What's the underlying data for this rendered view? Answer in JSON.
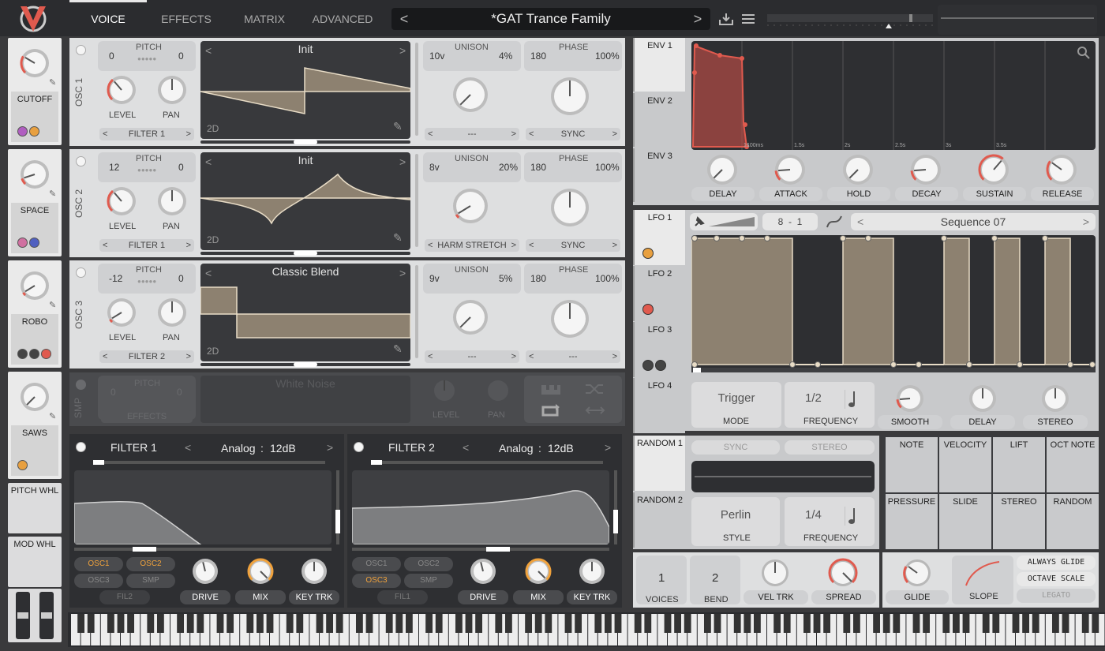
{
  "tabs": [
    "VOICE",
    "EFFECTS",
    "MATRIX",
    "ADVANCED"
  ],
  "preset": {
    "name": "*GAT Trance Family",
    "prev": "<",
    "next": ">"
  },
  "icons": {
    "save": "save-icon",
    "menu": "menu-icon",
    "search": "search-icon",
    "edit": "pencil-icon",
    "shuffle": "shuffle-icon",
    "loop": "loop-icon",
    "bounce": "bounce-icon",
    "keytrack": "keytrack-icon",
    "curve": "curve-icon",
    "note": "note-icon",
    "pin": "pin-icon"
  },
  "colors": {
    "accent": "#e05a4e",
    "brand_bg": "#2b2c2f",
    "panel": "#dedfe0",
    "wave_fill": "#8d8170",
    "orange": "#f0a23c"
  },
  "macros": [
    {
      "label": "CUTOFF",
      "value": 0.28
    },
    {
      "label": "SPACE",
      "value": 0.1
    },
    {
      "label": "ROBO",
      "value": 0.05
    },
    {
      "label": "SAWS",
      "value": 0.0
    },
    {
      "label": "PITCH WHL",
      "value": null
    },
    {
      "label": "MOD WHL",
      "value": null
    }
  ],
  "oscs": [
    {
      "label": "OSC 1",
      "pitch_left": "0",
      "pitch_right": "0",
      "pitch": "PITCH",
      "wave": "Init",
      "dim": "2D",
      "level": "LEVEL",
      "pan": "PAN",
      "filter": "FILTER 1",
      "unison_voices": "10v",
      "unison": "UNISON",
      "unison_detune": "4%",
      "phase_val": "180",
      "phase": "PHASE",
      "phase_rand": "100%",
      "spectral": "---",
      "sync": "SYNC"
    },
    {
      "label": "OSC 2",
      "pitch_left": "12",
      "pitch_right": "0",
      "pitch": "PITCH",
      "wave": "Init",
      "dim": "2D",
      "level": "LEVEL",
      "pan": "PAN",
      "filter": "FILTER 1",
      "unison_voices": "8v",
      "unison": "UNISON",
      "unison_detune": "20%",
      "phase_val": "180",
      "phase": "PHASE",
      "phase_rand": "100%",
      "spectral": "HARM STRETCH",
      "sync": "SYNC"
    },
    {
      "label": "OSC 3",
      "pitch_left": "-12",
      "pitch_right": "0",
      "pitch": "PITCH",
      "wave": "Classic Blend",
      "dim": "2D",
      "level": "LEVEL",
      "pan": "PAN",
      "filter": "FILTER 2",
      "unison_voices": "9v",
      "unison": "UNISON",
      "unison_detune": "5%",
      "phase_val": "180",
      "phase": "PHASE",
      "phase_rand": "100%",
      "spectral": "---",
      "sync": "---"
    }
  ],
  "smp": {
    "label": "SMP",
    "pitch": "PITCH",
    "pitch_left": "0",
    "pitch_right": "0",
    "dest": "EFFECTS",
    "sample": "White Noise",
    "level": "LEVEL",
    "pan": "PAN"
  },
  "filters": [
    {
      "title": "FILTER 1",
      "model": "Analog",
      "sep": ":",
      "slope": "12dB",
      "drive": "DRIVE",
      "mix": "MIX",
      "keytrk": "KEY TRK",
      "src": [
        "OSC1",
        "OSC2",
        "OSC3",
        "SMP"
      ],
      "active": [
        true,
        true,
        false,
        false
      ],
      "fil": "FIL2"
    },
    {
      "title": "FILTER 2",
      "model": "Analog",
      "sep": ":",
      "slope": "12dB",
      "drive": "DRIVE",
      "mix": "MIX",
      "keytrk": "KEY TRK",
      "src": [
        "OSC1",
        "OSC2",
        "OSC3",
        "SMP"
      ],
      "active": [
        false,
        false,
        true,
        false
      ],
      "fil": "FIL1"
    }
  ],
  "env": {
    "tabs": [
      "ENV 1",
      "ENV 2",
      "ENV 3"
    ],
    "times": [
      "100ms",
      "1s",
      "1.5s",
      "2s",
      "2.5s",
      "3s",
      "3.5s"
    ],
    "knobs": [
      "DELAY",
      "ATTACK",
      "HOLD",
      "DECAY",
      "SUSTAIN",
      "RELEASE"
    ]
  },
  "lfo": {
    "tabs": [
      "LFO 1",
      "LFO 2",
      "LFO 3",
      "LFO 4"
    ],
    "grid_num": "8",
    "grid_sep": "-",
    "grid_den": "1",
    "shape": "Sequence 07",
    "mode": "Trigger",
    "mode_lbl": "MODE",
    "freq": "1/2",
    "freq_lbl": "FREQUENCY",
    "smooth": "SMOOTH",
    "delay": "DELAY",
    "stereo": "STEREO"
  },
  "random": {
    "tabs": [
      "RANDOM 1",
      "RANDOM 2"
    ],
    "sync": "SYNC",
    "stereo": "STEREO",
    "style": "Perlin",
    "style_lbl": "STYLE",
    "freq": "1/4",
    "freq_lbl": "FREQUENCY"
  },
  "mod_sources": [
    "NOTE",
    "VELOCITY",
    "LIFT",
    "OCT NOTE",
    "PRESSURE",
    "SLIDE",
    "STEREO",
    "RANDOM"
  ],
  "voice": {
    "voices": "1",
    "voices_lbl": "VOICES",
    "bend": "2",
    "bend_lbl": "BEND",
    "veltrk": "VEL TRK",
    "spread": "SPREAD"
  },
  "glide": {
    "glide": "GLIDE",
    "slope": "SLOPE",
    "always": "ALWAYS GLIDE",
    "octave": "OCTAVE SCALE",
    "legato": "LEGATO"
  }
}
